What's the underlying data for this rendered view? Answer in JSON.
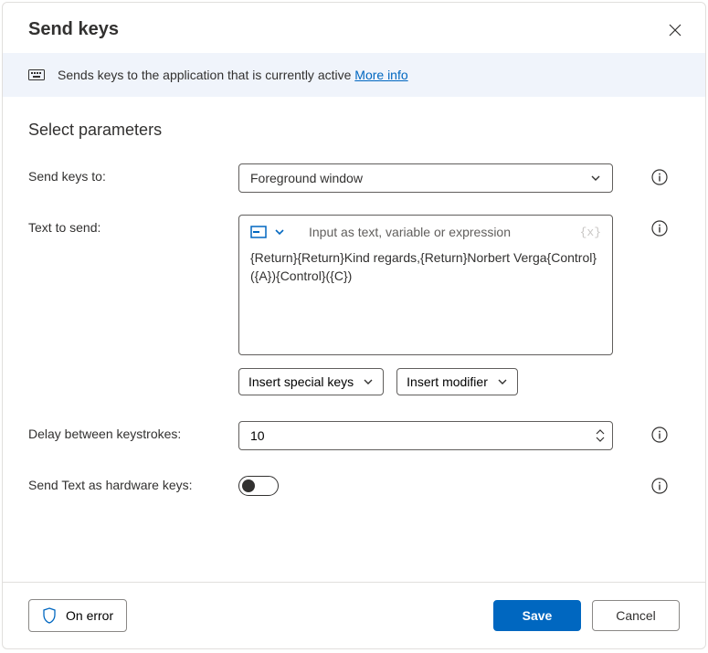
{
  "dialog": {
    "title": "Send keys"
  },
  "banner": {
    "text": "Sends keys to the application that is currently active ",
    "moreInfo": "More info"
  },
  "section": {
    "title": "Select parameters"
  },
  "fields": {
    "sendKeysTo": {
      "label": "Send keys to:",
      "value": "Foreground window"
    },
    "textToSend": {
      "label": "Text to send:",
      "placeholder": "Input as text, variable or expression",
      "varHint": "{x}",
      "value": "{Return}{Return}Kind regards,{Return}Norbert Verga{Control}({A}){Control}({C})"
    },
    "insertSpecialKeys": {
      "label": "Insert special keys"
    },
    "insertModifier": {
      "label": "Insert modifier"
    },
    "delay": {
      "label": "Delay between keystrokes:",
      "value": "10"
    },
    "hardwareKeys": {
      "label": "Send Text as hardware keys:",
      "value": false
    }
  },
  "footer": {
    "onError": "On error",
    "save": "Save",
    "cancel": "Cancel"
  }
}
